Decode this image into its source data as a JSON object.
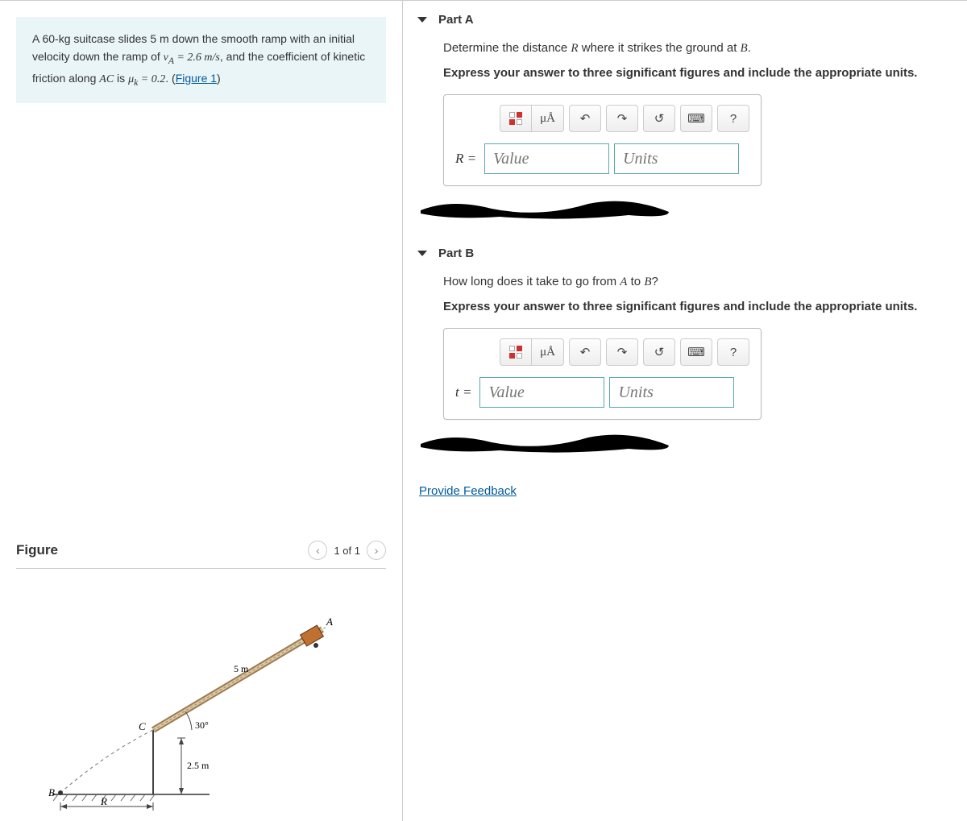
{
  "problem": {
    "mass": "60-kg",
    "object": "suitcase",
    "slide_dist": "5 m",
    "ramp_desc": "down the smooth ramp with an initial velocity down the ramp of",
    "vA_expr": "v_A = 2.6 m/s",
    "friction_desc": "and the coefficient of kinetic friction along",
    "segment": "AC",
    "mu_expr": "μ_k = 0.2",
    "figure_ref": "Figure 1"
  },
  "figure": {
    "title": "Figure",
    "pager": "1 of 1",
    "labels": {
      "A": "A",
      "C": "C",
      "B": "B",
      "R": "R",
      "five_m": "5 m",
      "angle": "30°",
      "two_five_m": "2.5 m"
    }
  },
  "parts": [
    {
      "title": "Part A",
      "question_html": "Determine the distance <span class='math'>R</span> where it strikes the ground at <span class='math'>B</span>.",
      "instruction": "Express your answer to three significant figures and include the appropriate units.",
      "label": "R =",
      "value_ph": "Value",
      "units_ph": "Units"
    },
    {
      "title": "Part B",
      "question_html": "How long does it take to go from <span class='math'>A</span> to <span class='math'>B</span>?",
      "instruction": "Express your answer to three significant figures and include the appropriate units.",
      "label": "t =",
      "value_ph": "Value",
      "units_ph": "Units"
    }
  ],
  "toolbar": {
    "unit_label": "μÅ",
    "help": "?"
  },
  "feedback": "Provide Feedback"
}
